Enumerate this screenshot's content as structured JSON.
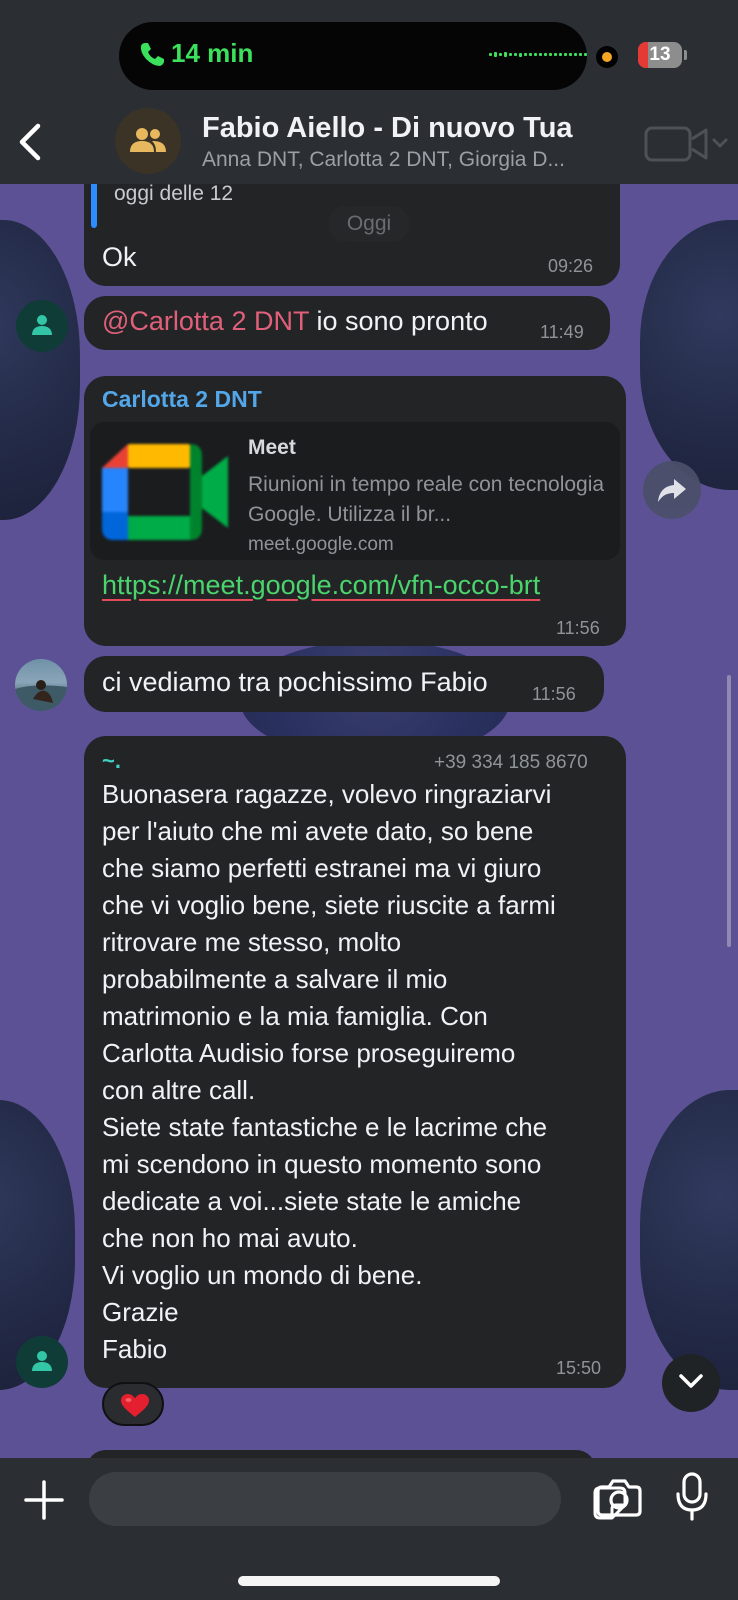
{
  "status": {
    "call_time": "14 min",
    "battery": "13"
  },
  "header": {
    "title": "Fabio Aiello - Di nuovo Tua",
    "subtitle": "Anna DNT, Carlotta 2 DNT, Giorgia D..."
  },
  "messages": {
    "quoted_snippet": "oggi delle 12",
    "date_divider": "Oggi",
    "ok": {
      "text": "Ok",
      "time": "09:26"
    },
    "ready": {
      "mention": "@Carlotta 2 DNT",
      "text": " io sono pronto",
      "time": "11:49"
    },
    "link": {
      "sender": "Carlotta 2 DNT",
      "preview_title": "Meet",
      "preview_desc": "Riunioni in tempo reale con tecnologia Google. Utilizza il br...",
      "preview_domain": "meet.google.com",
      "url": "https://meet.google.com/vfn-occo-brt",
      "time": "11:56"
    },
    "see_soon": {
      "text": "ci vediamo tra pochissimo Fabio",
      "time": "11:56"
    },
    "long": {
      "sender_name": "~.",
      "sender_phone": "+39 334 185 8670",
      "text": "Buonasera ragazze, volevo ringraziarvi\nper l'aiuto che mi avete dato, so bene\nche siamo perfetti estranei ma vi giuro\nche vi voglio bene, siete riuscite a farmi\nritrovare me stesso, molto\nprobabilmente a salvare il mio\nmatrimonio e la mia famiglia. Con\nCarlotta Audisio forse proseguiremo\ncon altre call.\nSiete state fantastiche e le lacrime che\nmi scendono in questo momento sono\ndedicate a voi...siete state le amiche\nche non ho mai avuto.\nVi voglio un mondo di bene.\nGrazie\nFabio",
      "time": "15:50",
      "reaction": "heart"
    }
  },
  "composer": {
    "placeholder": ""
  },
  "colors": {
    "accent_green": "#3be05c",
    "mention": "#e0607a",
    "sender_blue": "#53a6e8",
    "sender_teal": "#3fd0c0",
    "link_green": "#4bd36d"
  },
  "icons": [
    "phone-icon",
    "back-icon",
    "group-icon",
    "video-icon",
    "forward-icon",
    "person-icon",
    "heart-icon",
    "chevron-down-icon",
    "plus-icon",
    "sticker-icon",
    "camera-icon",
    "mic-icon"
  ]
}
